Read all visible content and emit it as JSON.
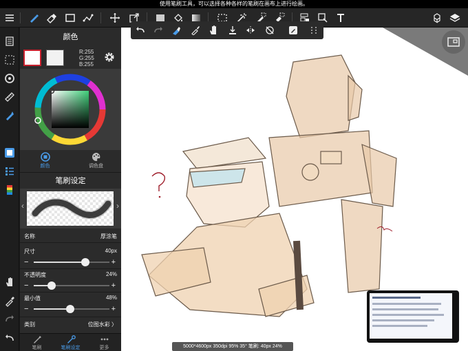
{
  "hint_text": "使用笔刷工具，可以选择各种各样的笔刷在画布上进行绘画。",
  "colors": {
    "accent": "#4a9be8",
    "panel": "#2b2b2b",
    "toolbar": "#262626",
    "main_color": "#ffffff",
    "main_color_border": "#c8202d"
  },
  "color_panel": {
    "title": "颜色",
    "rgb": {
      "r": "R:255",
      "g": "G:255",
      "b": "B:255"
    },
    "tabs": [
      {
        "label": "颜色",
        "icon": "color-circle-icon",
        "active": true
      },
      {
        "label": "调色盘",
        "icon": "palette-icon",
        "active": false
      }
    ]
  },
  "brush_panel": {
    "title": "笔刷设定",
    "props": [
      {
        "label": "名称",
        "value": "厚涂笔"
      },
      {
        "label": "尺寸",
        "value": "40px",
        "fraction": 0.68
      },
      {
        "label": "不透明度",
        "value": "24%",
        "fraction": 0.24
      },
      {
        "label": "最小值",
        "value": "48%",
        "fraction": 0.48
      },
      {
        "label": "类别",
        "value": "位图水彩 〉"
      }
    ],
    "minus": "−",
    "plus": "+",
    "prev_arrow": "‹",
    "next_arrow": "›"
  },
  "bottom_tabs": [
    {
      "label": "笔刷",
      "icon": "brush-icon",
      "active": false
    },
    {
      "label": "笔刷设定",
      "icon": "brush-settings-icon",
      "active": true
    },
    {
      "label": "更多",
      "icon": "more-icon",
      "active": false
    }
  ],
  "toolbar": {
    "menu": "menu-icon",
    "tools": [
      "brush-icon",
      "eraser-icon",
      "rectangle-icon",
      "pen-icon",
      "move-icon",
      "transform-icon",
      "fill-color-icon",
      "bucket-icon",
      "gradient-icon",
      "marquee-select-icon",
      "magic-wand-icon",
      "select-pen-icon",
      "select-eraser-icon",
      "cut-paste-icon",
      "text-icon",
      "materials-icon",
      "layers-icon"
    ]
  },
  "subtoolbar": [
    "undo-icon",
    "redo-icon",
    "clear-icon",
    "eyedropper-icon",
    "hand-icon",
    "import-icon",
    "flip-icon",
    "rotate-reset-icon",
    "edit-icon",
    "grid-menu-icon"
  ],
  "left_rail": [
    "layers-list-icon",
    "selection-icon",
    "snap-icon",
    "ruler-icon",
    "pen-tool-icon",
    "color-swatch-icon",
    "brush-list-icon",
    "palette-strip-icon",
    "hand-icon",
    "eyedropper-icon",
    "redo-icon",
    "undo-icon"
  ],
  "status_text": "5000*4600px 350dpi 95% 35° 笔刷: 40px 24%"
}
